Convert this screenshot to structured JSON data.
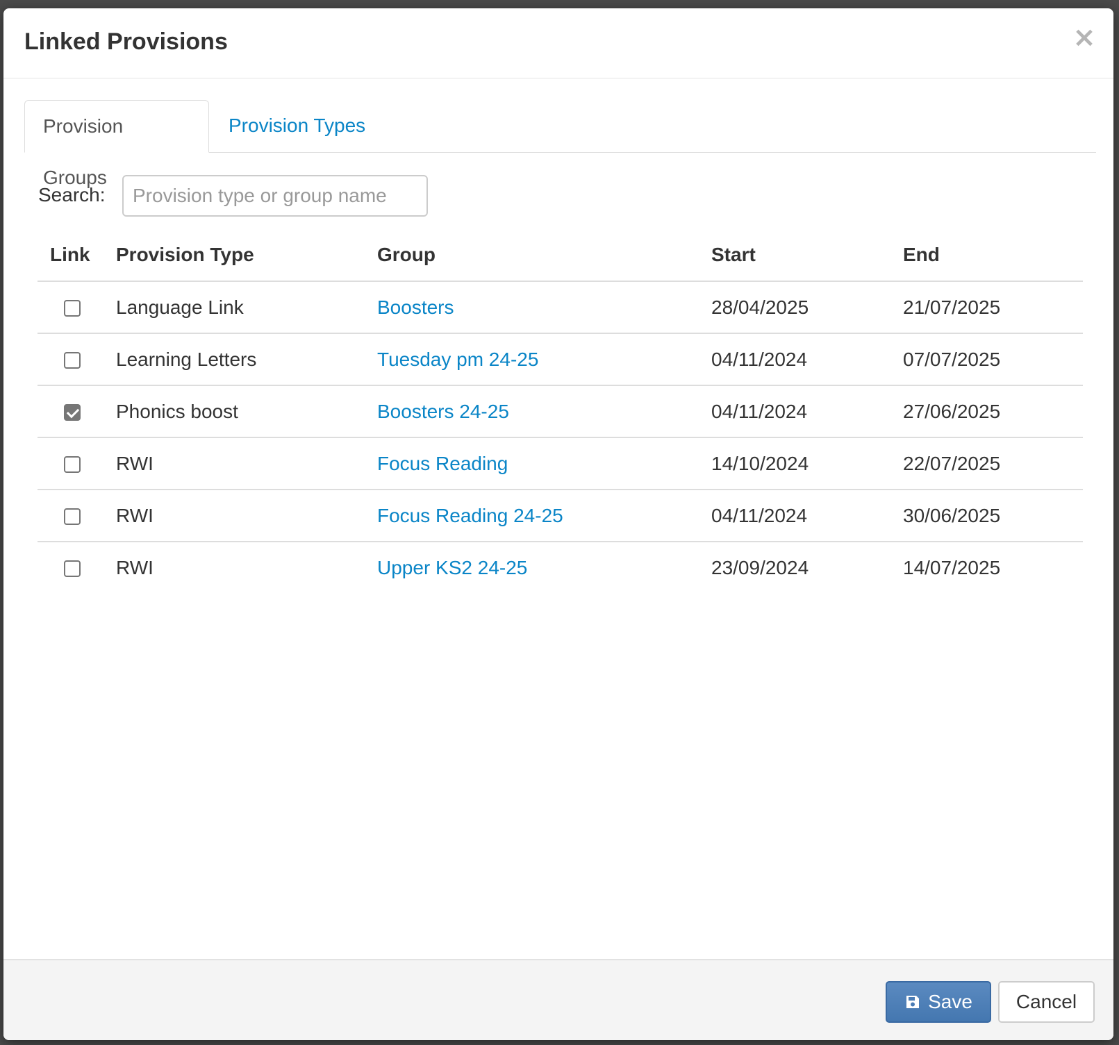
{
  "dialog": {
    "title": "Linked Provisions",
    "close_icon": "close-icon",
    "close_glyph": "×"
  },
  "tabs": [
    {
      "label": "Provision Groups",
      "active": true
    },
    {
      "label": "Provision Types",
      "active": false
    }
  ],
  "search": {
    "label": "Search:",
    "value": "",
    "placeholder": "Provision type or group name"
  },
  "table": {
    "columns": [
      "Link",
      "Provision Type",
      "Group",
      "Start",
      "End"
    ],
    "rows": [
      {
        "linked": false,
        "provision_type": "Language Link",
        "group": "Boosters",
        "start": "28/04/2025",
        "end": "21/07/2025"
      },
      {
        "linked": false,
        "provision_type": "Learning Letters",
        "group": "Tuesday pm 24-25",
        "start": "04/11/2024",
        "end": "07/07/2025"
      },
      {
        "linked": true,
        "provision_type": "Phonics boost",
        "group": "Boosters 24-25",
        "start": "04/11/2024",
        "end": "27/06/2025"
      },
      {
        "linked": false,
        "provision_type": "RWI",
        "group": "Focus Reading",
        "start": "14/10/2024",
        "end": "22/07/2025"
      },
      {
        "linked": false,
        "provision_type": "RWI",
        "group": "Focus Reading 24-25",
        "start": "04/11/2024",
        "end": "30/06/2025"
      },
      {
        "linked": false,
        "provision_type": "RWI",
        "group": "Upper KS2 24-25",
        "start": "23/09/2024",
        "end": "14/07/2025"
      }
    ]
  },
  "footer": {
    "save_label": "Save",
    "save_icon": "floppy-disk-icon",
    "cancel_label": "Cancel"
  },
  "colors": {
    "link": "#0a85c7",
    "primary_button": "#4a7cb5",
    "checkbox_checked": "#767676"
  }
}
